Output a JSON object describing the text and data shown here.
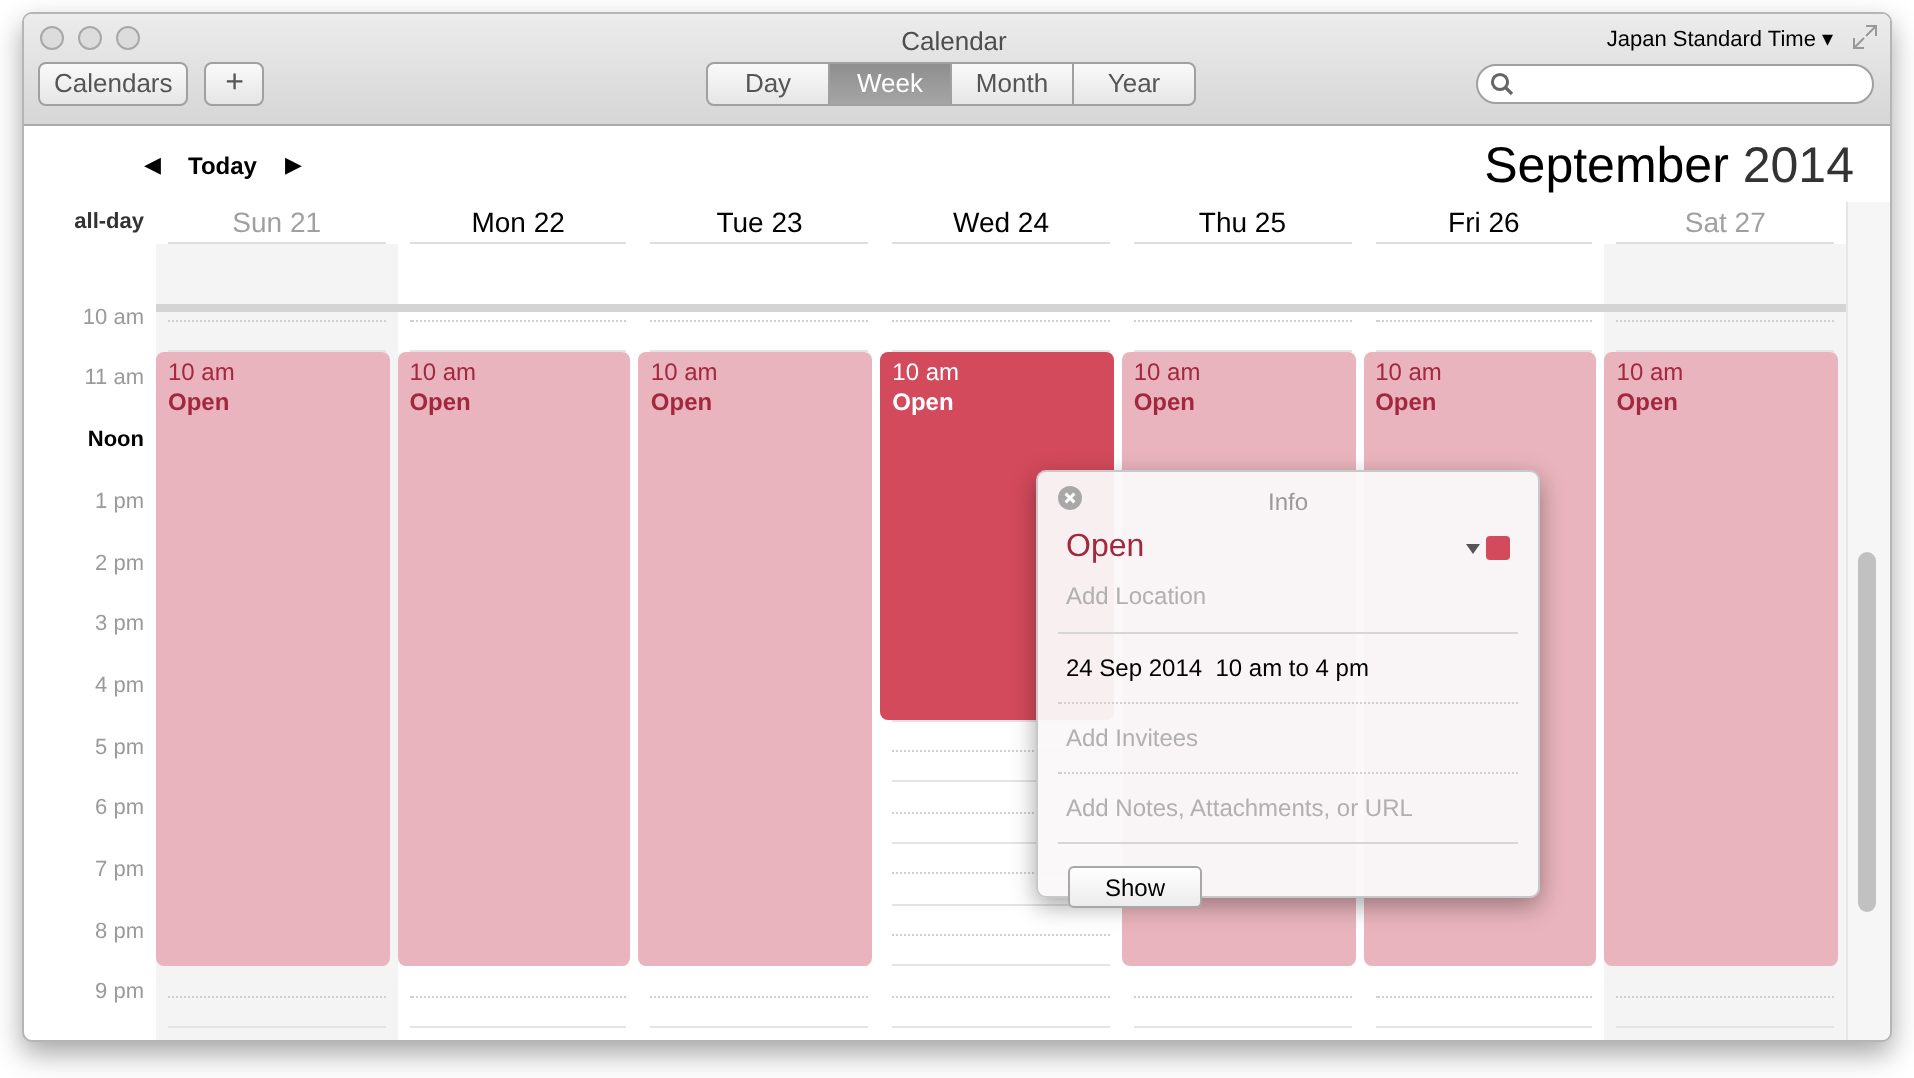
{
  "window": {
    "title": "Calendar",
    "timezone": "Japan Standard Time ▾"
  },
  "toolbar": {
    "buttons": [
      "Calendars",
      "+"
    ],
    "views": [
      {
        "label": "Day",
        "selected": false
      },
      {
        "label": "Week",
        "selected": true
      },
      {
        "label": "Month",
        "selected": false
      },
      {
        "label": "Year",
        "selected": false
      }
    ]
  },
  "nav": {
    "prev": "◀",
    "today": "Today",
    "next": "▶",
    "month": "September",
    "year": "2014"
  },
  "all_day_label": "all-day",
  "hours": [
    "10 am",
    "11 am",
    "Noon",
    "1 pm",
    "2 pm",
    "3 pm",
    "4 pm",
    "5 pm",
    "6 pm",
    "7 pm",
    "8 pm",
    "9 pm"
  ],
  "days": [
    {
      "label": "Sun 21",
      "weekend": true,
      "event": {
        "time": "10 am",
        "title": "Open",
        "selected": false
      }
    },
    {
      "label": "Mon 22",
      "weekend": false,
      "event": {
        "time": "10 am",
        "title": "Open",
        "selected": false
      }
    },
    {
      "label": "Tue 23",
      "weekend": false,
      "event": {
        "time": "10 am",
        "title": "Open",
        "selected": false
      }
    },
    {
      "label": "Wed 24",
      "weekend": false,
      "event": {
        "time": "10 am",
        "title": "Open",
        "selected": true
      }
    },
    {
      "label": "Thu 25",
      "weekend": false,
      "event": {
        "time": "10 am",
        "title": "Open",
        "selected": false
      }
    },
    {
      "label": "Fri 26",
      "weekend": false,
      "event": {
        "time": "10 am",
        "title": "Open",
        "selected": false
      }
    },
    {
      "label": "Sat 27",
      "weekend": true,
      "event": {
        "time": "10 am",
        "title": "Open",
        "selected": false
      }
    }
  ],
  "popover": {
    "header": "Info",
    "title": "Open",
    "color": "#d34a5c",
    "location_placeholder": "Add Location",
    "when": "24 Sep 2014  10 am to 4 pm",
    "invitees_placeholder": "Add Invitees",
    "notes_placeholder": "Add Notes, Attachments, or URL",
    "button": "Show"
  }
}
